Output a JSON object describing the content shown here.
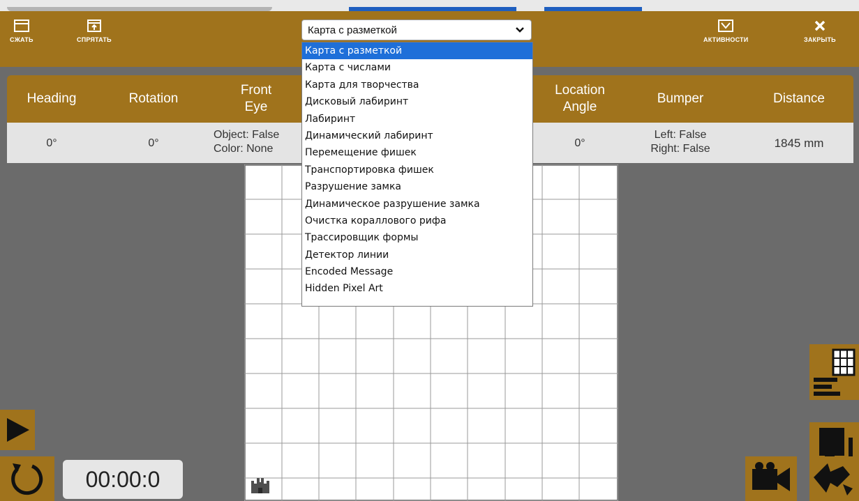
{
  "toolbar": {
    "collapse_label": "СЖАТЬ",
    "hide_label": "СПРЯТАТЬ",
    "activities_label": "АКТИВНОСТИ",
    "close_label": "ЗАКРЫТЬ"
  },
  "map_select": {
    "selected": "Карта с разметкой",
    "options": [
      "Карта с разметкой",
      "Карта с числами",
      "Карта для творчества",
      "Дисковый лабиринт",
      "Лабиринт",
      "Динамический лабиринт",
      "Перемещение фишек",
      "Транспортировка фишек",
      "Разрушение замка",
      "Динамическое разрушение замка",
      "Очистка кораллового рифа",
      "Трассировщик формы",
      "Детектор линии",
      "Encoded Message",
      "Hidden Pixel Art"
    ]
  },
  "telemetry": {
    "heading": {
      "label": "Heading",
      "value": "0°"
    },
    "rotation": {
      "label": "Rotation",
      "value": "0°"
    },
    "front_eye": {
      "label_line1": "Front",
      "label_line2": "Eye",
      "value_line1": "Object: False",
      "value_line2": "Color: None"
    },
    "location_angle": {
      "label_line1": "Location",
      "label_line2": "Angle",
      "value": "0°"
    },
    "bumper": {
      "label": "Bumper",
      "value_line1": "Left: False",
      "value_line2": "Right: False"
    },
    "distance": {
      "label": "Distance",
      "value": "1845 mm"
    }
  },
  "timer": {
    "value": "00:00:0"
  },
  "colors": {
    "accent": "#a0731c",
    "panel_bg": "#6b6b6b",
    "selection": "#1e6fd9"
  },
  "icons": {
    "collapse": "collapse-window-icon",
    "hide": "hide-panel-icon",
    "activities": "activities-check-icon",
    "close": "close-icon",
    "play": "play-icon",
    "reset": "reset-icon",
    "castle": "castle-icon",
    "map_editor": "map-editor-icon",
    "robot_view": "robot-view-icon",
    "camera": "camera-icon",
    "rotate_view": "rotate-view-icon"
  }
}
